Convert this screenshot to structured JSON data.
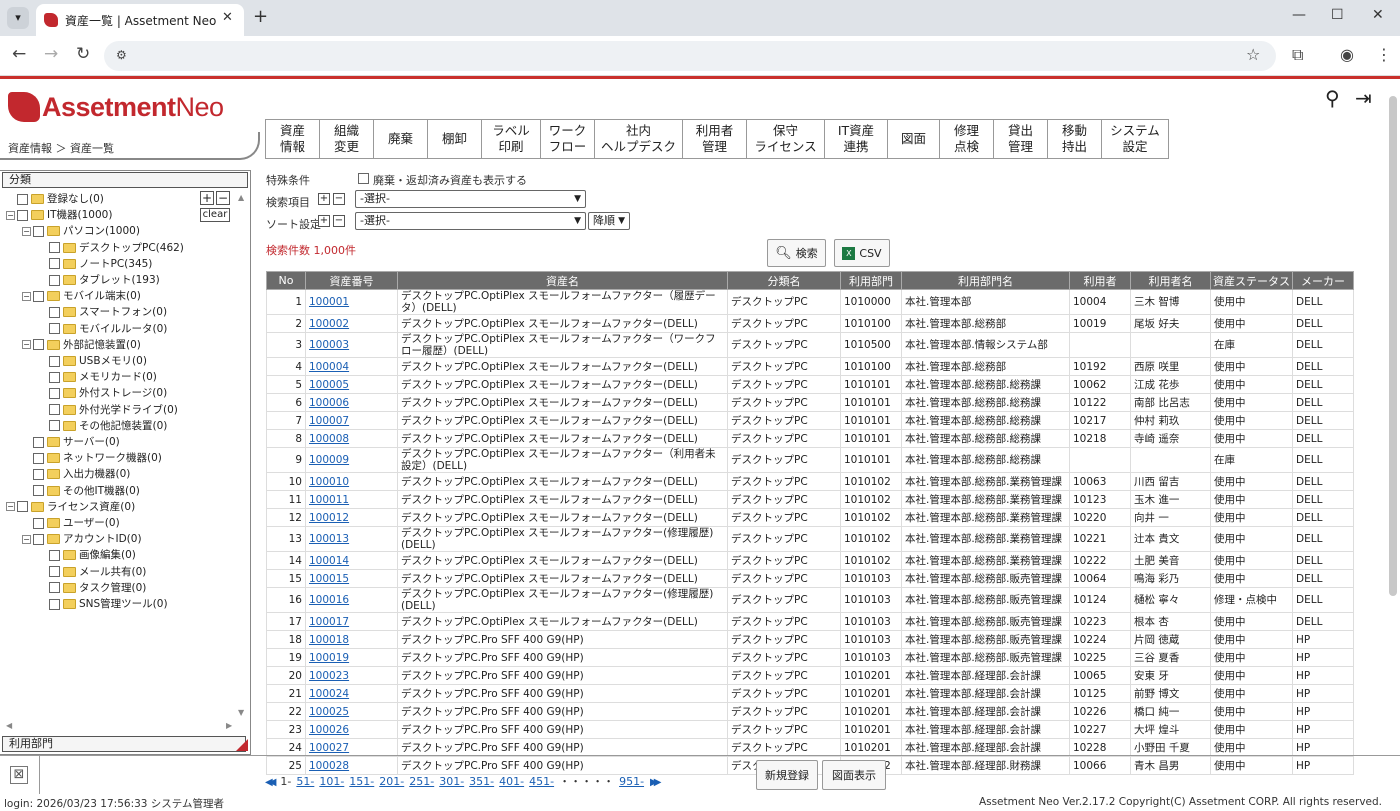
{
  "browser": {
    "tab_title": "資産一覧 | Assetment Neo",
    "new_tab_label": "+",
    "window_controls": [
      "—",
      "☐",
      "✕"
    ]
  },
  "app": {
    "logo_main": "Assetment",
    "logo_neo": "Neo",
    "breadcrumb": [
      "資産情報",
      "資産一覧"
    ],
    "menu": [
      "資産\n情報",
      "組織\n変更",
      "廃棄",
      "棚卸",
      "ラベル\n印刷",
      "ワーク\nフロー",
      "社内\nヘルプデスク",
      "利用者\n管理",
      "保守\nライセンス",
      "IT資産\n連携",
      "図面",
      "修理\n点検",
      "貸出\n管理",
      "移動\n持出",
      "システム\n設定"
    ]
  },
  "sidebar": {
    "header": "分類",
    "footer": "利用部門",
    "clear_label": "clear",
    "tree": [
      {
        "label": "登録なし(0)",
        "level": 0,
        "toggle": ""
      },
      {
        "label": "IT機器(1000)",
        "level": 0,
        "toggle": "−"
      },
      {
        "label": "パソコン(1000)",
        "level": 1,
        "toggle": "−"
      },
      {
        "label": "デスクトップPC(462)",
        "level": 2,
        "toggle": ""
      },
      {
        "label": "ノートPC(345)",
        "level": 2,
        "toggle": ""
      },
      {
        "label": "タブレット(193)",
        "level": 2,
        "toggle": ""
      },
      {
        "label": "モバイル端末(0)",
        "level": 1,
        "toggle": "−"
      },
      {
        "label": "スマートフォン(0)",
        "level": 2,
        "toggle": ""
      },
      {
        "label": "モバイルルータ(0)",
        "level": 2,
        "toggle": ""
      },
      {
        "label": "外部記憶装置(0)",
        "level": 1,
        "toggle": "−"
      },
      {
        "label": "USBメモリ(0)",
        "level": 2,
        "toggle": ""
      },
      {
        "label": "メモリカード(0)",
        "level": 2,
        "toggle": ""
      },
      {
        "label": "外付ストレージ(0)",
        "level": 2,
        "toggle": ""
      },
      {
        "label": "外付光学ドライブ(0)",
        "level": 2,
        "toggle": ""
      },
      {
        "label": "その他記憶装置(0)",
        "level": 2,
        "toggle": ""
      },
      {
        "label": "サーバー(0)",
        "level": 1,
        "toggle": ""
      },
      {
        "label": "ネットワーク機器(0)",
        "level": 1,
        "toggle": ""
      },
      {
        "label": "入出力機器(0)",
        "level": 1,
        "toggle": ""
      },
      {
        "label": "その他IT機器(0)",
        "level": 1,
        "toggle": ""
      },
      {
        "label": "ライセンス資産(0)",
        "level": 0,
        "toggle": "−"
      },
      {
        "label": "ユーザー(0)",
        "level": 1,
        "toggle": ""
      },
      {
        "label": "アカウントID(0)",
        "level": 1,
        "toggle": "−"
      },
      {
        "label": "画像編集(0)",
        "level": 2,
        "toggle": ""
      },
      {
        "label": "メール共有(0)",
        "level": 2,
        "toggle": ""
      },
      {
        "label": "タスク管理(0)",
        "level": 2,
        "toggle": ""
      },
      {
        "label": "SNS管理ツール(0)",
        "level": 2,
        "toggle": ""
      }
    ]
  },
  "search": {
    "special_label": "特殊条件",
    "special_checkbox": "廃棄・返却済み資産も表示する",
    "item_label": "検索項目",
    "sort_label": "ソート設定",
    "select_placeholder": "-選択-",
    "order": "降順",
    "count_text": "検索件数 1,000件",
    "search_button": "検索",
    "csv_button": "CSV"
  },
  "table": {
    "columns": [
      "No",
      "資産番号",
      "資産名",
      "分類名",
      "利用部門",
      "利用部門名",
      "利用者",
      "利用者名",
      "資産ステータス",
      "メーカー"
    ],
    "rows": [
      [
        "1",
        "100001",
        "デスクトップPC.OptiPlex スモールフォームファクター（履歴データ）(DELL)",
        "デスクトップPC",
        "1010000",
        "本社.管理本部",
        "10004",
        "三木 智博",
        "使用中",
        "DELL"
      ],
      [
        "2",
        "100002",
        "デスクトップPC.OptiPlex スモールフォームファクター(DELL)",
        "デスクトップPC",
        "1010100",
        "本社.管理本部.総務部",
        "10019",
        "尾坂 好夫",
        "使用中",
        "DELL"
      ],
      [
        "3",
        "100003",
        "デスクトップPC.OptiPlex スモールフォームファクター（ワークフロー履歴）(DELL)",
        "デスクトップPC",
        "1010500",
        "本社.管理本部.情報システム部",
        "",
        "",
        "在庫",
        "DELL"
      ],
      [
        "4",
        "100004",
        "デスクトップPC.OptiPlex スモールフォームファクター(DELL)",
        "デスクトップPC",
        "1010100",
        "本社.管理本部.総務部",
        "10192",
        "西原 咲里",
        "使用中",
        "DELL"
      ],
      [
        "5",
        "100005",
        "デスクトップPC.OptiPlex スモールフォームファクター(DELL)",
        "デスクトップPC",
        "1010101",
        "本社.管理本部.総務部.総務課",
        "10062",
        "江成 花歩",
        "使用中",
        "DELL"
      ],
      [
        "6",
        "100006",
        "デスクトップPC.OptiPlex スモールフォームファクター(DELL)",
        "デスクトップPC",
        "1010101",
        "本社.管理本部.総務部.総務課",
        "10122",
        "南部 比呂志",
        "使用中",
        "DELL"
      ],
      [
        "7",
        "100007",
        "デスクトップPC.OptiPlex スモールフォームファクター(DELL)",
        "デスクトップPC",
        "1010101",
        "本社.管理本部.総務部.総務課",
        "10217",
        "仲村 莉玖",
        "使用中",
        "DELL"
      ],
      [
        "8",
        "100008",
        "デスクトップPC.OptiPlex スモールフォームファクター(DELL)",
        "デスクトップPC",
        "1010101",
        "本社.管理本部.総務部.総務課",
        "10218",
        "寺崎 遥奈",
        "使用中",
        "DELL"
      ],
      [
        "9",
        "100009",
        "デスクトップPC.OptiPlex スモールフォームファクター（利用者未設定）(DELL)",
        "デスクトップPC",
        "1010101",
        "本社.管理本部.総務部.総務課",
        "",
        "",
        "在庫",
        "DELL"
      ],
      [
        "10",
        "100010",
        "デスクトップPC.OptiPlex スモールフォームファクター(DELL)",
        "デスクトップPC",
        "1010102",
        "本社.管理本部.総務部.業務管理課",
        "10063",
        "川西 留吉",
        "使用中",
        "DELL"
      ],
      [
        "11",
        "100011",
        "デスクトップPC.OptiPlex スモールフォームファクター(DELL)",
        "デスクトップPC",
        "1010102",
        "本社.管理本部.総務部.業務管理課",
        "10123",
        "玉木 進一",
        "使用中",
        "DELL"
      ],
      [
        "12",
        "100012",
        "デスクトップPC.OptiPlex スモールフォームファクター(DELL)",
        "デスクトップPC",
        "1010102",
        "本社.管理本部.総務部.業務管理課",
        "10220",
        "向井 一",
        "使用中",
        "DELL"
      ],
      [
        "13",
        "100013",
        "デスクトップPC.OptiPlex スモールフォームファクター(修理履歴)(DELL)",
        "デスクトップPC",
        "1010102",
        "本社.管理本部.総務部.業務管理課",
        "10221",
        "辻本 貴文",
        "使用中",
        "DELL"
      ],
      [
        "14",
        "100014",
        "デスクトップPC.OptiPlex スモールフォームファクター(DELL)",
        "デスクトップPC",
        "1010102",
        "本社.管理本部.総務部.業務管理課",
        "10222",
        "土肥 美音",
        "使用中",
        "DELL"
      ],
      [
        "15",
        "100015",
        "デスクトップPC.OptiPlex スモールフォームファクター(DELL)",
        "デスクトップPC",
        "1010103",
        "本社.管理本部.総務部.販売管理課",
        "10064",
        "鳴海 彩乃",
        "使用中",
        "DELL"
      ],
      [
        "16",
        "100016",
        "デスクトップPC.OptiPlex スモールフォームファクター(修理履歴)(DELL)",
        "デスクトップPC",
        "1010103",
        "本社.管理本部.総務部.販売管理課",
        "10124",
        "樋松 寧々",
        "修理・点検中",
        "DELL"
      ],
      [
        "17",
        "100017",
        "デスクトップPC.OptiPlex スモールフォームファクター(DELL)",
        "デスクトップPC",
        "1010103",
        "本社.管理本部.総務部.販売管理課",
        "10223",
        "根本 杏",
        "使用中",
        "DELL"
      ],
      [
        "18",
        "100018",
        "デスクトップPC.Pro SFF 400 G9(HP)",
        "デスクトップPC",
        "1010103",
        "本社.管理本部.総務部.販売管理課",
        "10224",
        "片岡 徳蔵",
        "使用中",
        "HP"
      ],
      [
        "19",
        "100019",
        "デスクトップPC.Pro SFF 400 G9(HP)",
        "デスクトップPC",
        "1010103",
        "本社.管理本部.総務部.販売管理課",
        "10225",
        "三谷 夏香",
        "使用中",
        "HP"
      ],
      [
        "20",
        "100023",
        "デスクトップPC.Pro SFF 400 G9(HP)",
        "デスクトップPC",
        "1010201",
        "本社.管理本部.経理部.会計課",
        "10065",
        "安東 牙",
        "使用中",
        "HP"
      ],
      [
        "21",
        "100024",
        "デスクトップPC.Pro SFF 400 G9(HP)",
        "デスクトップPC",
        "1010201",
        "本社.管理本部.経理部.会計課",
        "10125",
        "前野 博文",
        "使用中",
        "HP"
      ],
      [
        "22",
        "100025",
        "デスクトップPC.Pro SFF 400 G9(HP)",
        "デスクトップPC",
        "1010201",
        "本社.管理本部.経理部.会計課",
        "10226",
        "橋口 純一",
        "使用中",
        "HP"
      ],
      [
        "23",
        "100026",
        "デスクトップPC.Pro SFF 400 G9(HP)",
        "デスクトップPC",
        "1010201",
        "本社.管理本部.経理部.会計課",
        "10227",
        "大坪 煌斗",
        "使用中",
        "HP"
      ],
      [
        "24",
        "100027",
        "デスクトップPC.Pro SFF 400 G9(HP)",
        "デスクトップPC",
        "1010201",
        "本社.管理本部.経理部.会計課",
        "10228",
        "小野田 千夏",
        "使用中",
        "HP"
      ],
      [
        "25",
        "100028",
        "デスクトップPC.Pro SFF 400 G9(HP)",
        "デスクトップPC",
        "1010202",
        "本社.管理本部.経理部.財務課",
        "10066",
        "青木 昌男",
        "使用中",
        "HP"
      ]
    ]
  },
  "pagination": {
    "pages": [
      "1-",
      "51-",
      "101-",
      "151-",
      "201-",
      "251-",
      "301-",
      "351-",
      "401-",
      "451-"
    ],
    "ellipsis": "・・・・・",
    "last": "951-"
  },
  "footer": {
    "new_button": "新規登録",
    "map_button": "図面表示",
    "login_text": "login: 2026/03/23 17:56:33 システム管理者",
    "copyright": "Assetment Neo Ver.2.17.2 Copyright(C) Assetment CORP. All rights reserved."
  }
}
